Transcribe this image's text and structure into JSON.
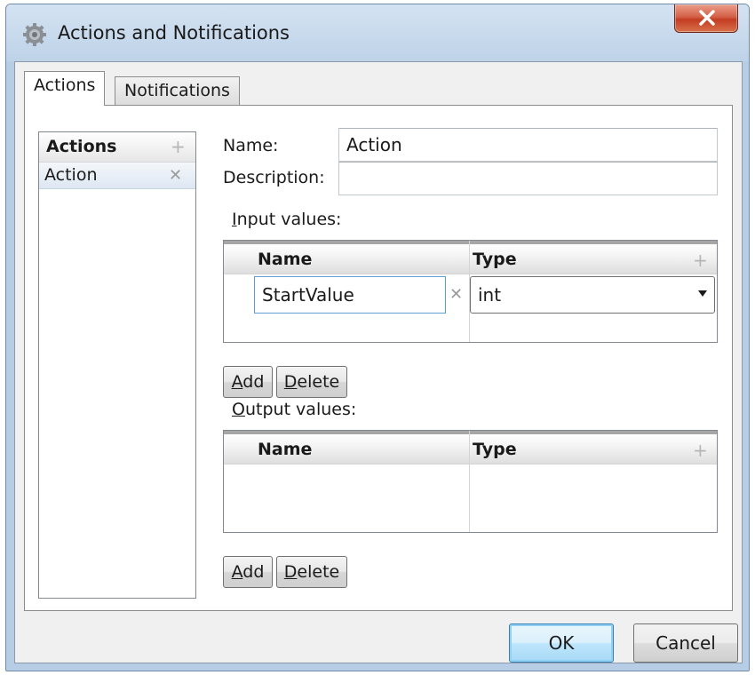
{
  "window": {
    "title": "Actions and Notifications"
  },
  "tabs": [
    {
      "label": "Actions",
      "selected": true
    },
    {
      "label": "Notifications",
      "selected": false
    }
  ],
  "actions_list": {
    "header": "Actions",
    "items": [
      {
        "label": "Action",
        "selected": true
      }
    ]
  },
  "form": {
    "name_label": "Name:",
    "name_value": "Action",
    "description_label": "Description:",
    "description_value": ""
  },
  "input_values": {
    "label_mnemonic": "I",
    "label_rest": "nput values:",
    "columns": [
      "Name",
      "Type"
    ],
    "rows": [
      {
        "name": "StartValue",
        "type": "int"
      }
    ],
    "add_mnemonic": "A",
    "add_rest": "dd",
    "delete_mnemonic": "D",
    "delete_rest": "elete"
  },
  "output_values": {
    "label_mnemonic": "O",
    "label_rest": "utput values:",
    "columns": [
      "Name",
      "Type"
    ],
    "rows": [],
    "add_mnemonic": "A",
    "add_rest": "dd",
    "delete_mnemonic": "D",
    "delete_rest": "elete"
  },
  "footer": {
    "ok_label": "OK",
    "cancel_label": "Cancel"
  },
  "icons": {
    "window": "gear-icon",
    "close": "close-icon",
    "add": "plus-icon",
    "remove": "x-icon",
    "dropdown": "chevron-down-icon"
  },
  "colors": {
    "close_button": "#c9482b",
    "default_button_border": "#3c7fb1",
    "selection_row": "#dde7f2"
  }
}
